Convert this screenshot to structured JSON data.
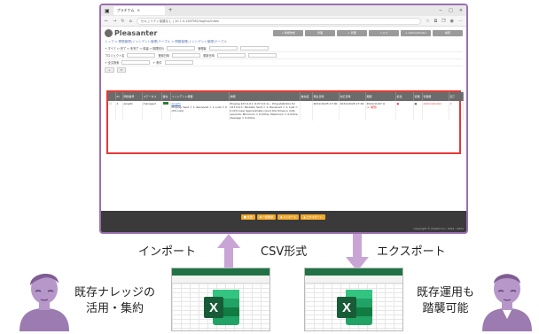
{
  "browser": {
    "tab_title": "プラチナム",
    "url_text": "セキュリティ保護なし | 10.7.4.18/ITMS/faq/list/index",
    "window_controls": [
      "−",
      "□",
      "×"
    ]
  },
  "app": {
    "logo": "Pleasanter",
    "nav": [
      "+ 新規作成",
      "管理",
      "+ 管理",
      "ヘルプ",
      "+ Administrator",
      "検索"
    ]
  },
  "breadcrumb": "トップ > 問題管理(インシデント管理)テーブル > 問題管理(インシデント管理)テーブル",
  "filters": {
    "row1": "+ すべて  ○ 完了  ○ 未完了  ○ 保留  ○ 期限切れ",
    "row1b": "管理者",
    "row2a": "プロジェクト名",
    "row2b": "登録日時",
    "row2c": "更新日時",
    "row3": "+ 全文検索",
    "row3b": "+ 条件"
  },
  "table": {
    "headers": [
      "",
      "ID",
      "問題番号",
      "ステータス",
      "優先",
      "インシデント概要",
      "詳細",
      "優先度",
      "発生日時",
      "対応日時",
      "期限",
      "担当",
      "管理",
      "管理者",
      "完了"
    ],
    "row": {
      "id": "1",
      "num": "ping01",
      "status": "managed",
      "summary_link": "ping01",
      "summary": "Pinging: Sent = 1, Received = 1, Lost = 0 (0% lost)",
      "detail": "Pinging 127.0.0.1 (127.0.0.1)... Ping statistics for 127.0.0.1: Packets: Sent = 1, Received = 1, Lost = 0 (0% loss) Approximate round trip times in milli-seconds: Minimum = 0.03ms, Maximum = 0.03ms, Average = 0.03ms",
      "occurred": "2021/10/25 17:00",
      "handled": "2021/10/26 17:00",
      "due": "2021/11/07 ※",
      "due_note": "(+ 期限)",
      "owner": "Administrator"
    }
  },
  "footer": {
    "buttons": [
      "■ 全選",
      "◆ 一括削除",
      "◆ インポート",
      "▲ エクスポート"
    ],
    "copyright": "Copyright © Implem Inc. 2014 - 2021"
  },
  "labels": {
    "import": "インポート",
    "csv": "CSV形式",
    "export": "エクスポート"
  },
  "captions": {
    "left": [
      "既存ナレッジの",
      "活用・集約"
    ],
    "right": [
      "既存運用も",
      "踏襲可能"
    ]
  },
  "excel_logo_letter": "X",
  "colors": {
    "frame": "#9a6fb0",
    "highlight": "#e53935",
    "arrow": "#c9a5d6",
    "excel_green": "#217346",
    "person": "#9c7bb0"
  }
}
